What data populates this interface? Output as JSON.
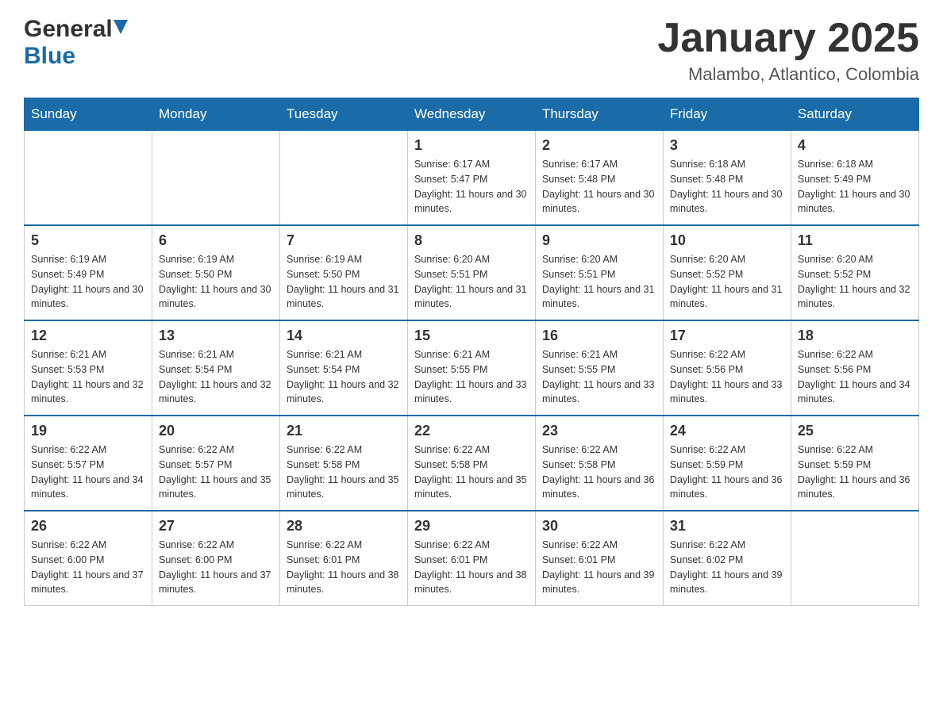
{
  "header": {
    "logo_general": "General",
    "logo_blue": "Blue",
    "month_title": "January 2025",
    "location": "Malambo, Atlantico, Colombia"
  },
  "days_of_week": [
    "Sunday",
    "Monday",
    "Tuesday",
    "Wednesday",
    "Thursday",
    "Friday",
    "Saturday"
  ],
  "weeks": [
    [
      {
        "day": "",
        "sunrise": "",
        "sunset": "",
        "daylight": ""
      },
      {
        "day": "",
        "sunrise": "",
        "sunset": "",
        "daylight": ""
      },
      {
        "day": "",
        "sunrise": "",
        "sunset": "",
        "daylight": ""
      },
      {
        "day": "1",
        "sunrise": "Sunrise: 6:17 AM",
        "sunset": "Sunset: 5:47 PM",
        "daylight": "Daylight: 11 hours and 30 minutes."
      },
      {
        "day": "2",
        "sunrise": "Sunrise: 6:17 AM",
        "sunset": "Sunset: 5:48 PM",
        "daylight": "Daylight: 11 hours and 30 minutes."
      },
      {
        "day": "3",
        "sunrise": "Sunrise: 6:18 AM",
        "sunset": "Sunset: 5:48 PM",
        "daylight": "Daylight: 11 hours and 30 minutes."
      },
      {
        "day": "4",
        "sunrise": "Sunrise: 6:18 AM",
        "sunset": "Sunset: 5:49 PM",
        "daylight": "Daylight: 11 hours and 30 minutes."
      }
    ],
    [
      {
        "day": "5",
        "sunrise": "Sunrise: 6:19 AM",
        "sunset": "Sunset: 5:49 PM",
        "daylight": "Daylight: 11 hours and 30 minutes."
      },
      {
        "day": "6",
        "sunrise": "Sunrise: 6:19 AM",
        "sunset": "Sunset: 5:50 PM",
        "daylight": "Daylight: 11 hours and 30 minutes."
      },
      {
        "day": "7",
        "sunrise": "Sunrise: 6:19 AM",
        "sunset": "Sunset: 5:50 PM",
        "daylight": "Daylight: 11 hours and 31 minutes."
      },
      {
        "day": "8",
        "sunrise": "Sunrise: 6:20 AM",
        "sunset": "Sunset: 5:51 PM",
        "daylight": "Daylight: 11 hours and 31 minutes."
      },
      {
        "day": "9",
        "sunrise": "Sunrise: 6:20 AM",
        "sunset": "Sunset: 5:51 PM",
        "daylight": "Daylight: 11 hours and 31 minutes."
      },
      {
        "day": "10",
        "sunrise": "Sunrise: 6:20 AM",
        "sunset": "Sunset: 5:52 PM",
        "daylight": "Daylight: 11 hours and 31 minutes."
      },
      {
        "day": "11",
        "sunrise": "Sunrise: 6:20 AM",
        "sunset": "Sunset: 5:52 PM",
        "daylight": "Daylight: 11 hours and 32 minutes."
      }
    ],
    [
      {
        "day": "12",
        "sunrise": "Sunrise: 6:21 AM",
        "sunset": "Sunset: 5:53 PM",
        "daylight": "Daylight: 11 hours and 32 minutes."
      },
      {
        "day": "13",
        "sunrise": "Sunrise: 6:21 AM",
        "sunset": "Sunset: 5:54 PM",
        "daylight": "Daylight: 11 hours and 32 minutes."
      },
      {
        "day": "14",
        "sunrise": "Sunrise: 6:21 AM",
        "sunset": "Sunset: 5:54 PM",
        "daylight": "Daylight: 11 hours and 32 minutes."
      },
      {
        "day": "15",
        "sunrise": "Sunrise: 6:21 AM",
        "sunset": "Sunset: 5:55 PM",
        "daylight": "Daylight: 11 hours and 33 minutes."
      },
      {
        "day": "16",
        "sunrise": "Sunrise: 6:21 AM",
        "sunset": "Sunset: 5:55 PM",
        "daylight": "Daylight: 11 hours and 33 minutes."
      },
      {
        "day": "17",
        "sunrise": "Sunrise: 6:22 AM",
        "sunset": "Sunset: 5:56 PM",
        "daylight": "Daylight: 11 hours and 33 minutes."
      },
      {
        "day": "18",
        "sunrise": "Sunrise: 6:22 AM",
        "sunset": "Sunset: 5:56 PM",
        "daylight": "Daylight: 11 hours and 34 minutes."
      }
    ],
    [
      {
        "day": "19",
        "sunrise": "Sunrise: 6:22 AM",
        "sunset": "Sunset: 5:57 PM",
        "daylight": "Daylight: 11 hours and 34 minutes."
      },
      {
        "day": "20",
        "sunrise": "Sunrise: 6:22 AM",
        "sunset": "Sunset: 5:57 PM",
        "daylight": "Daylight: 11 hours and 35 minutes."
      },
      {
        "day": "21",
        "sunrise": "Sunrise: 6:22 AM",
        "sunset": "Sunset: 5:58 PM",
        "daylight": "Daylight: 11 hours and 35 minutes."
      },
      {
        "day": "22",
        "sunrise": "Sunrise: 6:22 AM",
        "sunset": "Sunset: 5:58 PM",
        "daylight": "Daylight: 11 hours and 35 minutes."
      },
      {
        "day": "23",
        "sunrise": "Sunrise: 6:22 AM",
        "sunset": "Sunset: 5:58 PM",
        "daylight": "Daylight: 11 hours and 36 minutes."
      },
      {
        "day": "24",
        "sunrise": "Sunrise: 6:22 AM",
        "sunset": "Sunset: 5:59 PM",
        "daylight": "Daylight: 11 hours and 36 minutes."
      },
      {
        "day": "25",
        "sunrise": "Sunrise: 6:22 AM",
        "sunset": "Sunset: 5:59 PM",
        "daylight": "Daylight: 11 hours and 36 minutes."
      }
    ],
    [
      {
        "day": "26",
        "sunrise": "Sunrise: 6:22 AM",
        "sunset": "Sunset: 6:00 PM",
        "daylight": "Daylight: 11 hours and 37 minutes."
      },
      {
        "day": "27",
        "sunrise": "Sunrise: 6:22 AM",
        "sunset": "Sunset: 6:00 PM",
        "daylight": "Daylight: 11 hours and 37 minutes."
      },
      {
        "day": "28",
        "sunrise": "Sunrise: 6:22 AM",
        "sunset": "Sunset: 6:01 PM",
        "daylight": "Daylight: 11 hours and 38 minutes."
      },
      {
        "day": "29",
        "sunrise": "Sunrise: 6:22 AM",
        "sunset": "Sunset: 6:01 PM",
        "daylight": "Daylight: 11 hours and 38 minutes."
      },
      {
        "day": "30",
        "sunrise": "Sunrise: 6:22 AM",
        "sunset": "Sunset: 6:01 PM",
        "daylight": "Daylight: 11 hours and 39 minutes."
      },
      {
        "day": "31",
        "sunrise": "Sunrise: 6:22 AM",
        "sunset": "Sunset: 6:02 PM",
        "daylight": "Daylight: 11 hours and 39 minutes."
      },
      {
        "day": "",
        "sunrise": "",
        "sunset": "",
        "daylight": ""
      }
    ]
  ]
}
